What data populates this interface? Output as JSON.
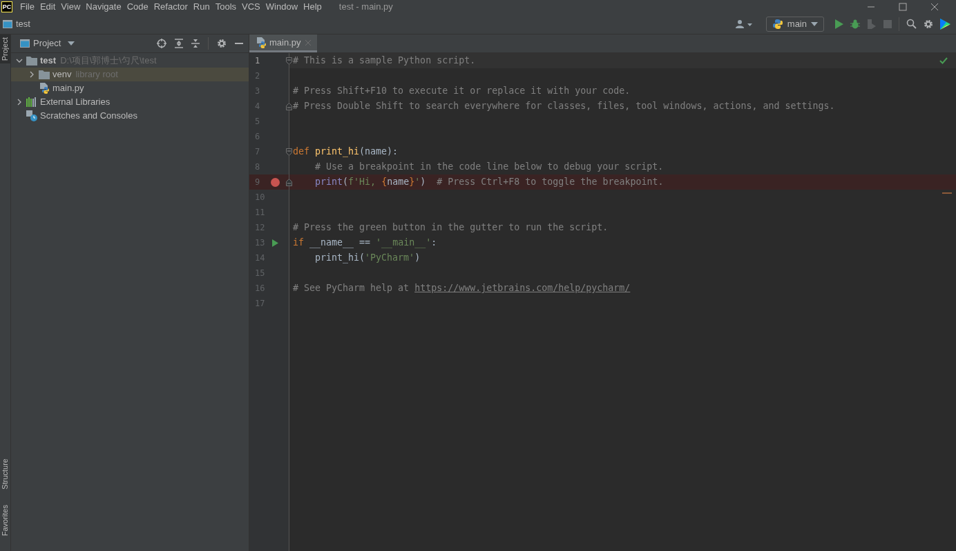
{
  "app_logo": "PC",
  "menu": [
    "File",
    "Edit",
    "View",
    "Navigate",
    "Code",
    "Refactor",
    "Run",
    "Tools",
    "VCS",
    "Window",
    "Help"
  ],
  "window": {
    "title": "test - main.py"
  },
  "breadcrumb": "test",
  "run_config": "main",
  "side_tabs_top": [
    {
      "label": "Project",
      "selected": true
    }
  ],
  "side_tabs_bottom": [
    {
      "label": "Structure",
      "selected": false
    },
    {
      "label": "Favorites",
      "selected": false
    }
  ],
  "project_panel": {
    "title": "Project",
    "tree": [
      {
        "label": "test",
        "detail": "D:\\项目\\郭博士\\匀尺\\test",
        "kind": "folder",
        "expanded": true,
        "selected": false,
        "children": [
          {
            "label": "venv",
            "detail": "library root",
            "kind": "folder",
            "expanded": false,
            "selected": true
          },
          {
            "label": "main.py",
            "kind": "python",
            "selected": false
          }
        ]
      },
      {
        "label": "External Libraries",
        "kind": "libraries",
        "expanded": false,
        "selected": false
      },
      {
        "label": "Scratches and Consoles",
        "kind": "scratches",
        "selected": false
      }
    ]
  },
  "tabs": [
    {
      "label": "main.py",
      "selected": true
    }
  ],
  "code_lines": [
    {
      "number": "1",
      "current": true,
      "breakpoint": false,
      "run_gutter": false,
      "fold_start": true,
      "fold_end": false,
      "tokens": [
        {
          "kind": "comment",
          "text": "# This is a sample Python script."
        }
      ]
    },
    {
      "number": "2",
      "current": false,
      "breakpoint": false,
      "run_gutter": false,
      "fold_start": false,
      "fold_end": false
    },
    {
      "number": "3",
      "current": false,
      "breakpoint": false,
      "run_gutter": false,
      "fold_start": false,
      "fold_end": false,
      "tokens": [
        {
          "kind": "comment",
          "text": "# Press Shift+F10 to execute it or replace it with your code."
        }
      ]
    },
    {
      "number": "4",
      "current": false,
      "breakpoint": false,
      "run_gutter": false,
      "fold_start": false,
      "fold_end": true,
      "tokens": [
        {
          "kind": "comment",
          "text": "# Press Double Shift to search everywhere for classes, files, tool windows, actions, and settings."
        }
      ]
    },
    {
      "number": "5",
      "current": false,
      "breakpoint": false,
      "run_gutter": false,
      "fold_start": false,
      "fold_end": false
    },
    {
      "number": "6",
      "current": false,
      "breakpoint": false,
      "run_gutter": false,
      "fold_start": false,
      "fold_end": false
    },
    {
      "number": "7",
      "current": false,
      "breakpoint": false,
      "run_gutter": false,
      "fold_start": true,
      "fold_end": false,
      "tokens": [
        {
          "kind": "keyword",
          "text": "def "
        },
        {
          "kind": "function",
          "text": "print_hi"
        },
        {
          "kind": "plain",
          "text": "(name):"
        }
      ]
    },
    {
      "number": "8",
      "current": false,
      "breakpoint": false,
      "run_gutter": false,
      "fold_start": false,
      "fold_end": false,
      "tokens": [
        {
          "kind": "comment",
          "text": "    # Use a breakpoint in the code line below to debug your script."
        }
      ]
    },
    {
      "number": "9",
      "current": false,
      "breakpoint": true,
      "run_gutter": false,
      "fold_start": false,
      "fold_end": true,
      "tokens": [
        {
          "kind": "builtin",
          "text": "    print"
        },
        {
          "kind": "plain",
          "text": "("
        },
        {
          "kind": "string",
          "text": "f'Hi, "
        },
        {
          "kind": "brace",
          "text": "{"
        },
        {
          "kind": "plain",
          "text": "name"
        },
        {
          "kind": "brace",
          "text": "}"
        },
        {
          "kind": "string",
          "text": "'"
        },
        {
          "kind": "plain",
          "text": ")  "
        },
        {
          "kind": "comment",
          "text": "# Press Ctrl+F8 to toggle the breakpoint."
        }
      ]
    },
    {
      "number": "10",
      "current": false,
      "breakpoint": false,
      "run_gutter": false,
      "fold_start": false,
      "fold_end": false
    },
    {
      "number": "11",
      "current": false,
      "breakpoint": false,
      "run_gutter": false,
      "fold_start": false,
      "fold_end": false
    },
    {
      "number": "12",
      "current": false,
      "breakpoint": false,
      "run_gutter": false,
      "fold_start": false,
      "fold_end": false,
      "tokens": [
        {
          "kind": "comment",
          "text": "# Press the green button in the gutter to run the script."
        }
      ]
    },
    {
      "number": "13",
      "current": false,
      "breakpoint": false,
      "run_gutter": true,
      "fold_start": false,
      "fold_end": false,
      "tokens": [
        {
          "kind": "keyword",
          "text": "if "
        },
        {
          "kind": "plain",
          "text": "__name__ == "
        },
        {
          "kind": "string",
          "text": "'__main__'"
        },
        {
          "kind": "plain",
          "text": ":"
        }
      ]
    },
    {
      "number": "14",
      "current": false,
      "breakpoint": false,
      "run_gutter": false,
      "fold_start": false,
      "fold_end": false,
      "tokens": [
        {
          "kind": "plain",
          "text": "    print_hi("
        },
        {
          "kind": "string",
          "text": "'PyCharm'"
        },
        {
          "kind": "plain",
          "text": ")"
        }
      ]
    },
    {
      "number": "15",
      "current": false,
      "breakpoint": false,
      "run_gutter": false,
      "fold_start": false,
      "fold_end": false
    },
    {
      "number": "16",
      "current": false,
      "breakpoint": false,
      "run_gutter": false,
      "fold_start": false,
      "fold_end": false,
      "tokens": [
        {
          "kind": "comment",
          "text": "# See PyCharm help at "
        },
        {
          "kind": "link",
          "text": "https://www.jetbrains.com/help/pycharm/"
        }
      ]
    },
    {
      "number": "17",
      "current": false,
      "breakpoint": false,
      "run_gutter": false,
      "fold_start": false,
      "fold_end": false
    }
  ]
}
